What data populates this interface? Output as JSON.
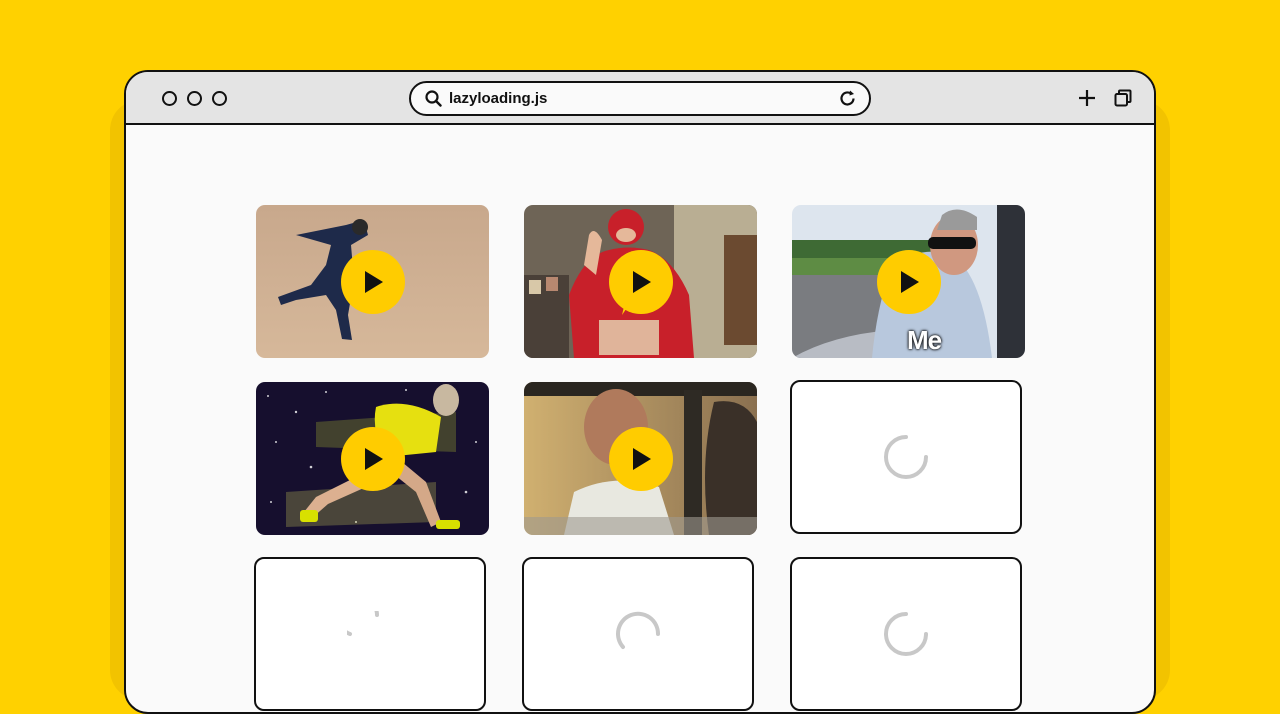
{
  "browser": {
    "url": "lazyloading.js"
  },
  "icons": {
    "search": "search-icon",
    "reload": "reload-icon",
    "new_tab": "plus-icon",
    "tabs": "tabs-icon",
    "play": "play-icon",
    "spinner": "spinner-icon"
  },
  "colors": {
    "background": "#FFD100",
    "play_button": "#FFCC00",
    "border": "#111111"
  },
  "grid": {
    "videos": [
      {
        "state": "loaded",
        "caption": ""
      },
      {
        "state": "loaded",
        "caption": ""
      },
      {
        "state": "loaded",
        "caption": "Me"
      },
      {
        "state": "loaded",
        "caption": ""
      },
      {
        "state": "loaded",
        "caption": ""
      },
      {
        "state": "loading",
        "caption": ""
      },
      {
        "state": "loading",
        "caption": ""
      },
      {
        "state": "loading",
        "caption": ""
      },
      {
        "state": "loading",
        "caption": ""
      }
    ]
  }
}
